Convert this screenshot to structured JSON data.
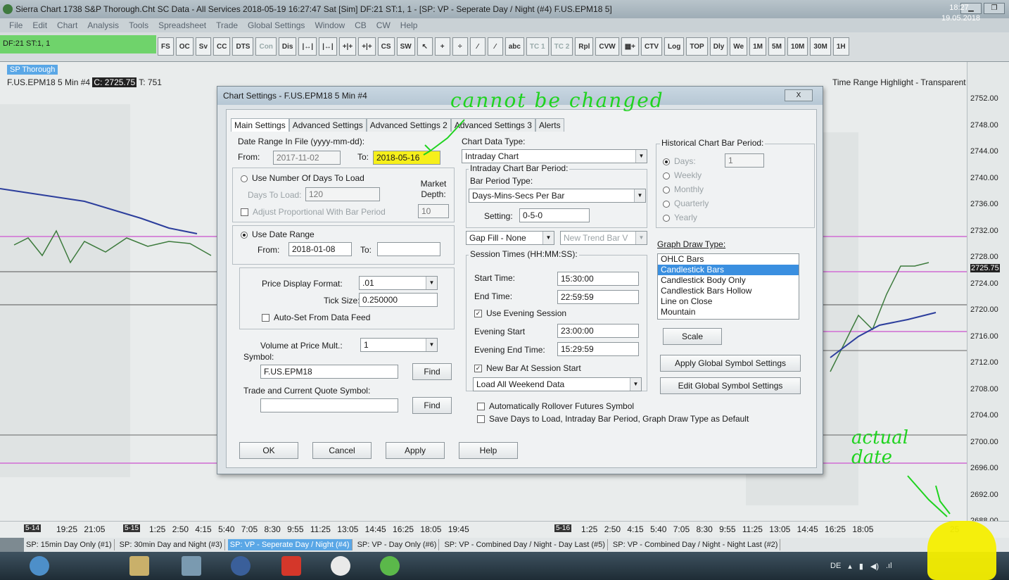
{
  "window": {
    "title": "Sierra Chart 1738 S&P Thorough.Cht  SC Data - All Services 2018-05-19  16:27:47 Sat [Sim]  DF:21  ST:1, 1 - [SP: VP - Seperate Day / Night (#4)  F.US.EPM18  5]"
  },
  "menu": [
    "File",
    "Edit",
    "Chart",
    "Analysis",
    "Tools",
    "Spreadsheet",
    "Trade",
    "Global Settings",
    "Window",
    "CB",
    "CW",
    "Help"
  ],
  "toolbar": {
    "status": "DF:21  ST:1, 1",
    "buttons": [
      "FS",
      "OC",
      "Sv",
      "CC",
      "DTS",
      "Con",
      "Dis",
      "|↔|",
      "|↔|",
      "+|+",
      "+|+",
      "CS",
      "SW",
      "↖",
      "+",
      "÷",
      "⁄",
      "⁄",
      "abc",
      "TC 1",
      "TC 2",
      "Rpl",
      "CVW",
      "▦+",
      "CTV",
      "Log",
      "TOP",
      "Dly",
      "We",
      "1M",
      "5M",
      "10M",
      "30M",
      "1H"
    ],
    "dim_buttons": [
      "Con",
      "TC 1",
      "TC 2"
    ]
  },
  "chart": {
    "tag": "SP Thorough",
    "symbol_info": "F.US.EPM18  5 Min  #4",
    "close_label": "C: 2725.75",
    "t_label": "T: 751",
    "info_tail": "Time Range Highlight - Transparent  Tr",
    "price_labels": [
      "2752.00",
      "2748.00",
      "2744.00",
      "2740.00",
      "2736.00",
      "2732.00",
      "2728.00",
      "2725.75",
      "2724.00",
      "2720.00",
      "2716.00",
      "2712.00",
      "2708.00",
      "2704.00",
      "2700.00",
      "2696.00",
      "2692.00",
      "2688.00"
    ],
    "time_axis_left_date": "5-14",
    "time_axis_left": "19:25  21:05",
    "time_axis_date2": "5-15",
    "time_axis_mid": "1:25  2:50  4:15  5:40  7:05  8:30  9:55  11:25  13:05  14:45  16:25  18:05  19:45",
    "time_axis_date3": "5-16",
    "time_axis_right": "1:25  2:50  4:15  5:40  7:05  8:30  9:55  11:25  13:05  14:45  16:25  18:05",
    "time_axis_end": "25"
  },
  "tabs": [
    "SP: 15min Day Only (#1)",
    "SP: 30min Day and Night (#3)",
    "SP: VP - Seperate Day / Night (#4)",
    "SP: VP - Day Only (#6)",
    "SP: VP - Combined Day / Night - Day Last (#5)",
    "SP: VP - Combined Day / Night - Night Last (#2)"
  ],
  "active_tab_index": 2,
  "taskbar": {
    "lang": "DE",
    "time": "18:27",
    "date": "19.05.2018"
  },
  "dialog": {
    "title": "Chart Settings - F.US.EPM18  5 Min  #4",
    "close": "X",
    "tabs": [
      "Main Settings",
      "Advanced Settings",
      "Advanced Settings 2",
      "Advanced Settings 3",
      "Alerts"
    ],
    "date_range_label": "Date Range In File (yyyy-mm-dd):",
    "from_label": "From:",
    "from_value": "2017-11-02",
    "to_label": "To:",
    "to_value": "2018-05-16",
    "use_days_label": "Use Number Of Days To Load",
    "days_to_load_label": "Days To Load:",
    "days_to_load_value": "120",
    "market_depth_label": "Market Depth:",
    "market_depth_value": "10",
    "adjust_label": "Adjust Proportional With Bar Period",
    "use_date_range_label": "Use Date Range",
    "dr_from_label": "From:",
    "dr_from_value": "2018-01-08",
    "dr_to_label": "To:",
    "dr_to_value": "",
    "price_format_label": "Price Display Format:",
    "price_format_value": ".01",
    "tick_size_label": "Tick Size:",
    "tick_size_value": "0.250000",
    "autoset_label": "Auto-Set From Data Feed",
    "vap_label": "Volume at Price Mult.:",
    "vap_value": "1",
    "symbol_label": "Symbol:",
    "symbol_value": "F.US.EPM18",
    "find_label": "Find",
    "trade_symbol_label": "Trade and Current Quote Symbol:",
    "trade_symbol_value": "",
    "chart_data_type_label": "Chart Data Type:",
    "chart_data_type_value": "Intraday Chart",
    "intraday_period_label": "Intraday Chart Bar Period:",
    "bar_period_type_label": "Bar Period Type:",
    "bar_period_type_value": "Days-Mins-Secs Per Bar",
    "setting_label": "Setting:",
    "setting_value": "0-5-0",
    "gap_fill_value": "Gap Fill - None",
    "new_trend_value": "New Trend Bar V",
    "session_label": "Session Times (HH:MM:SS):",
    "start_time_label": "Start Time:",
    "start_time_value": "15:30:00",
    "end_time_label": "End Time:",
    "end_time_value": "22:59:59",
    "use_evening_label": "Use Evening Session",
    "evening_start_label": "Evening Start",
    "evening_start_value": "23:00:00",
    "evening_end_label": "Evening End Time:",
    "evening_end_value": "15:29:59",
    "new_bar_label": "New Bar At Session Start",
    "weekend_value": "Load All Weekend Data",
    "historical_label": "Historical Chart Bar Period:",
    "hist_options": [
      "Days:",
      "Weekly",
      "Monthly",
      "Quarterly",
      "Yearly"
    ],
    "hist_days_value": "1",
    "graph_draw_label": "Graph Draw Type:",
    "graph_draw_options": [
      "OHLC Bars",
      "Candlestick Bars",
      "Candlestick Body Only",
      "Candlestick Bars Hollow",
      "Line on Close",
      "Mountain"
    ],
    "graph_draw_selected": 1,
    "scale_label": "Scale",
    "apply_global_label": "Apply Global Symbol Settings",
    "edit_global_label": "Edit Global Symbol Settings",
    "auto_rollover_label": "Automatically Rollover Futures Symbol",
    "save_days_label": "Save Days to Load, Intraday Bar Period, Graph Draw Type as Default",
    "ok_label": "OK",
    "cancel_label": "Cancel",
    "apply_label": "Apply",
    "help_label": "Help"
  },
  "annotations": {
    "top": "cannot be changed",
    "bottom_line1": "actual",
    "bottom_line2": "date"
  },
  "colors": {
    "annotation": "#1fd31f",
    "highlight": "#f6ef1b",
    "selection": "#3a8fe0",
    "tab_active": "#5aa7e6",
    "df_green": "#6fd36b"
  }
}
